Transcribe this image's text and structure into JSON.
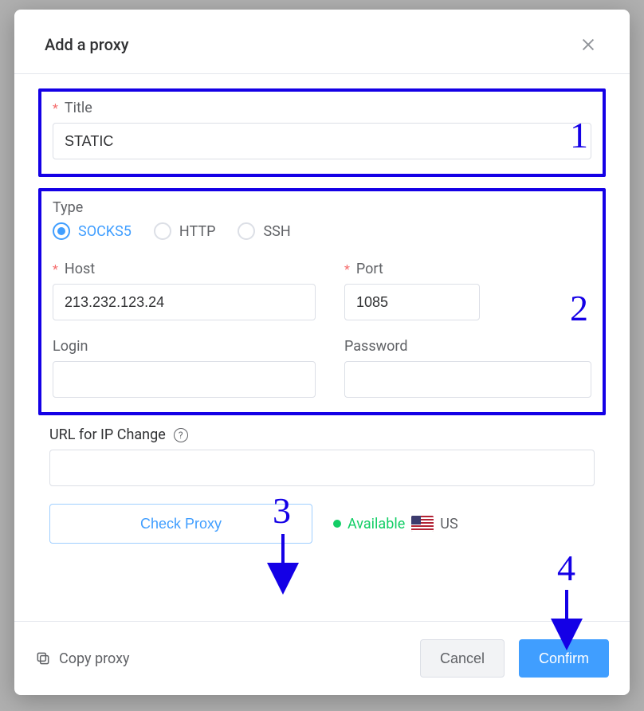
{
  "header": {
    "title": "Add a proxy"
  },
  "title_field": {
    "label": "Title",
    "value": "STATIC"
  },
  "type_field": {
    "label": "Type",
    "options": [
      "SOCKS5",
      "HTTP",
      "SSH"
    ],
    "selected": "SOCKS5"
  },
  "host_field": {
    "label": "Host",
    "value": "213.232.123.24"
  },
  "port_field": {
    "label": "Port",
    "value": "1085"
  },
  "login_field": {
    "label": "Login",
    "value": ""
  },
  "password_field": {
    "label": "Password",
    "value": ""
  },
  "url_change_field": {
    "label": "URL for IP Change",
    "value": ""
  },
  "check_proxy": {
    "button_label": "Check Proxy",
    "status_text": "Available",
    "country_code": "US"
  },
  "footer": {
    "copy_label": "Copy proxy",
    "cancel_label": "Cancel",
    "confirm_label": "Confirm"
  },
  "annotations": {
    "n1": "1",
    "n2": "2",
    "n3": "3",
    "n4": "4"
  }
}
